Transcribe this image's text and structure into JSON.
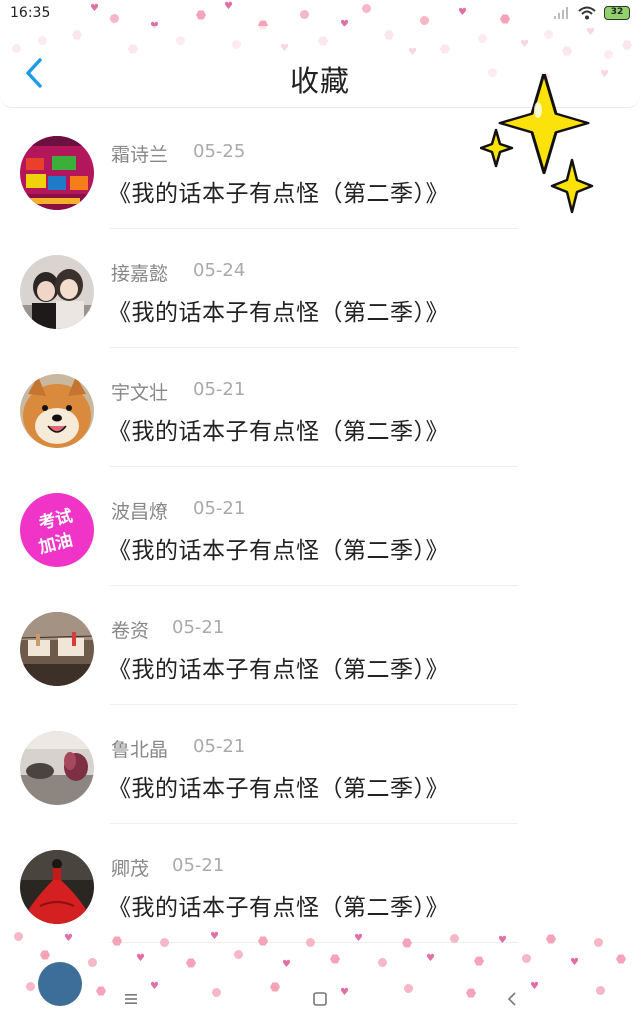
{
  "status_bar": {
    "time": "16:35",
    "battery": "32"
  },
  "header": {
    "title": "收藏"
  },
  "favorites": [
    {
      "name": "霜诗兰",
      "date": "05-25",
      "title": "《我的话本子有点怪（第二季）》",
      "avatar": "collage-avatar"
    },
    {
      "name": "接嘉懿",
      "date": "05-24",
      "title": "《我的话本子有点怪（第二季）》",
      "avatar": "couple-avatar"
    },
    {
      "name": "宇文壮",
      "date": "05-21",
      "title": "《我的话本子有点怪（第二季）》",
      "avatar": "shiba-dog-avatar"
    },
    {
      "name": "波昌燎",
      "date": "05-21",
      "title": "《我的话本子有点怪（第二季）》",
      "avatar": "exam-cheer-avatar"
    },
    {
      "name": "卷资",
      "date": "05-21",
      "title": "《我的话本子有点怪（第二季）》",
      "avatar": "clothespin-avatar"
    },
    {
      "name": "鲁北晶",
      "date": "05-21",
      "title": "《我的话本子有点怪（第二季）》",
      "avatar": "flower-avatar"
    },
    {
      "name": "卿茂",
      "date": "05-21",
      "title": "《我的话本子有点怪（第二季）》",
      "avatar": "red-gown-avatar"
    }
  ],
  "avatar_texts": {
    "exam_cheer": [
      "考试",
      "加油"
    ]
  },
  "colors": {
    "accent": "#1e9be8",
    "confetti_pink": "#f6b7c6",
    "heart": "#e070a8",
    "sparkle": "#fbe20a"
  },
  "icons": {
    "back": "back-arrow-icon",
    "sparkles": "sparkles-icon",
    "nav_menu": "menu-icon",
    "nav_home": "home-square-icon",
    "nav_back": "back-chevron-icon"
  }
}
